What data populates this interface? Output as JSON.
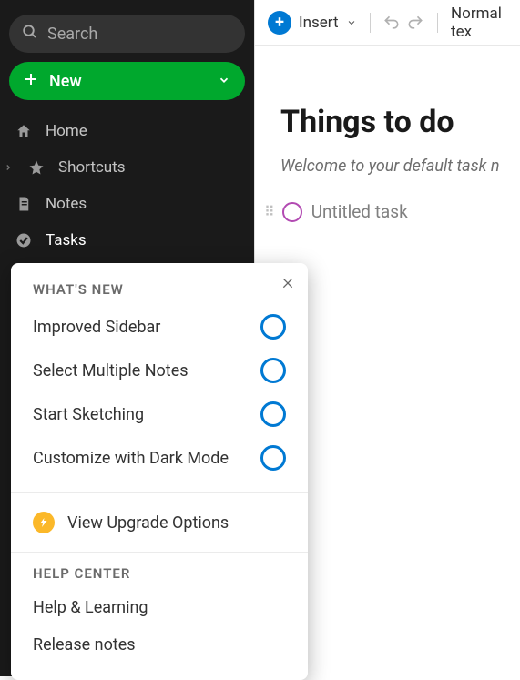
{
  "sidebar": {
    "search_placeholder": "Search",
    "new_label": "New",
    "items": [
      {
        "label": "Home",
        "icon": "home"
      },
      {
        "label": "Shortcuts",
        "icon": "star",
        "expandable": true
      },
      {
        "label": "Notes",
        "icon": "notes"
      },
      {
        "label": "Tasks",
        "icon": "tasks",
        "active": true
      }
    ]
  },
  "toolbar": {
    "insert_label": "Insert",
    "style_label": "Normal tex"
  },
  "doc": {
    "title": "Things to do",
    "welcome": "Welcome to your default task n",
    "task0": "Untitled task"
  },
  "popover": {
    "whats_new_heading": "WHAT'S NEW",
    "items": [
      "Improved Sidebar",
      "Select Multiple Notes",
      "Start Sketching",
      "Customize with Dark Mode"
    ],
    "upgrade_label": "View Upgrade Options",
    "help_heading": "HELP CENTER",
    "help_items": [
      "Help & Learning",
      "Release notes"
    ]
  }
}
